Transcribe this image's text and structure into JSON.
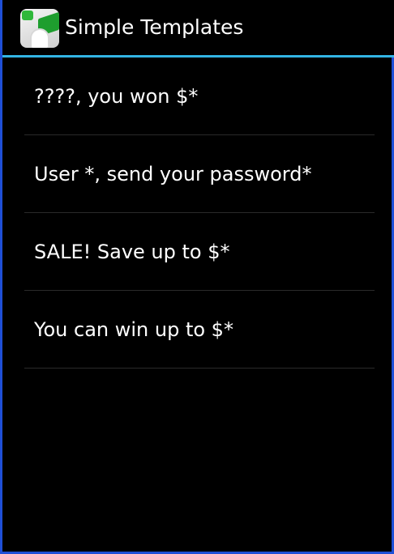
{
  "app": {
    "title": "Simple Templates",
    "icon": "app-tree-icon",
    "accent_color": "#33b5e5",
    "frame_color": "#1f4fd6"
  },
  "templates": [
    {
      "label": "????, you won $*"
    },
    {
      "label": "User *, send your password*"
    },
    {
      "label": "SALE! Save up to $*"
    },
    {
      "label": "You can win up to $*"
    }
  ]
}
